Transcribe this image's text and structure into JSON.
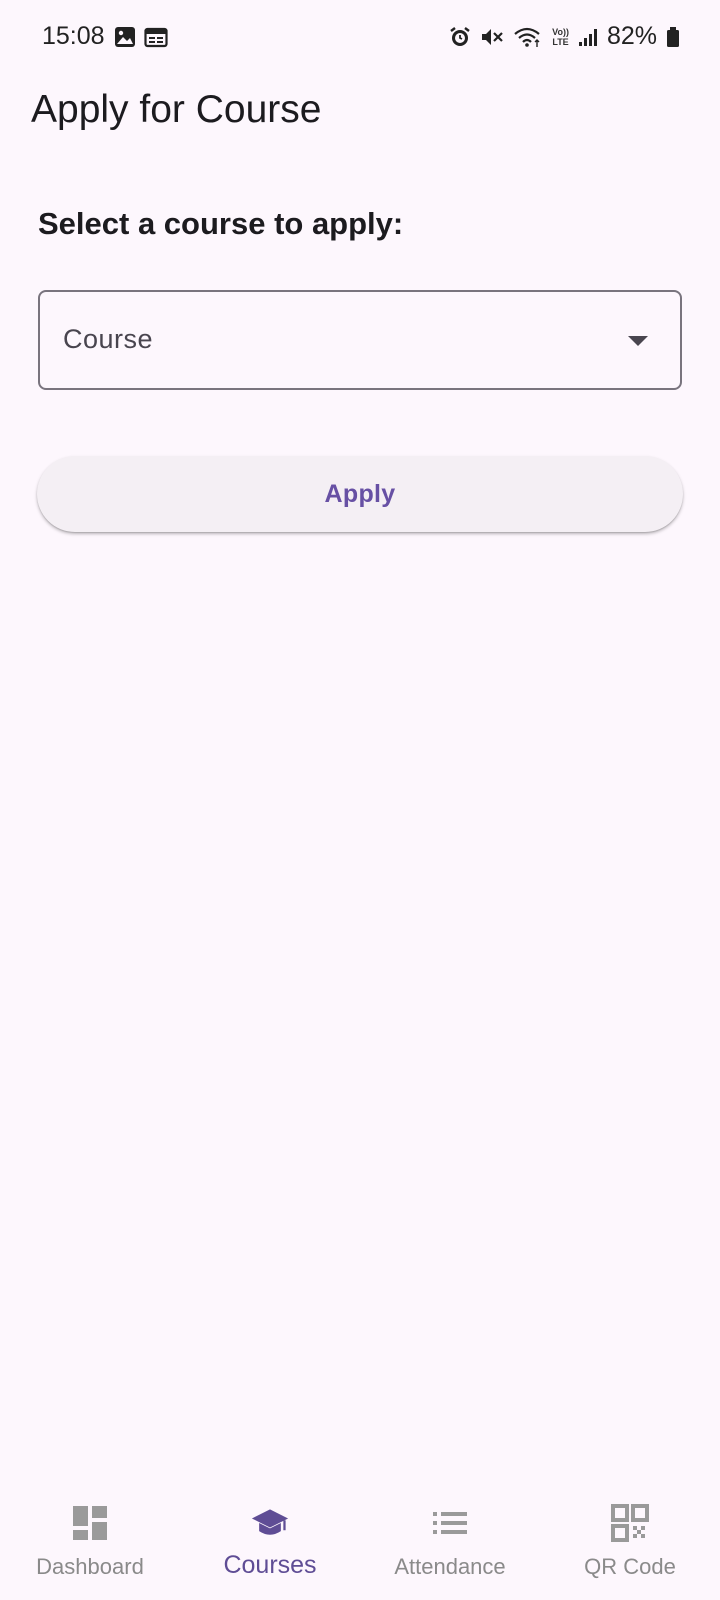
{
  "status_bar": {
    "time": "15:08",
    "battery": "82%",
    "network_label_top": "Vo))",
    "network_label_bottom": "LTE"
  },
  "header": {
    "title": "Apply for Course"
  },
  "form": {
    "section_label": "Select a course to apply:",
    "course_dropdown": {
      "selected_value": "Course",
      "options": []
    },
    "apply_label": "Apply"
  },
  "bottom_nav": {
    "active_index": 1,
    "items": [
      {
        "label": "Dashboard",
        "icon": "dashboard-icon"
      },
      {
        "label": "Courses",
        "icon": "graduation-cap-icon"
      },
      {
        "label": "Attendance",
        "icon": "list-icon"
      },
      {
        "label": "QR Code",
        "icon": "qr-code-icon"
      }
    ]
  },
  "colors": {
    "background": "#fdf7fd",
    "accent": "#6750a4",
    "inactive": "#8a8a8a"
  }
}
